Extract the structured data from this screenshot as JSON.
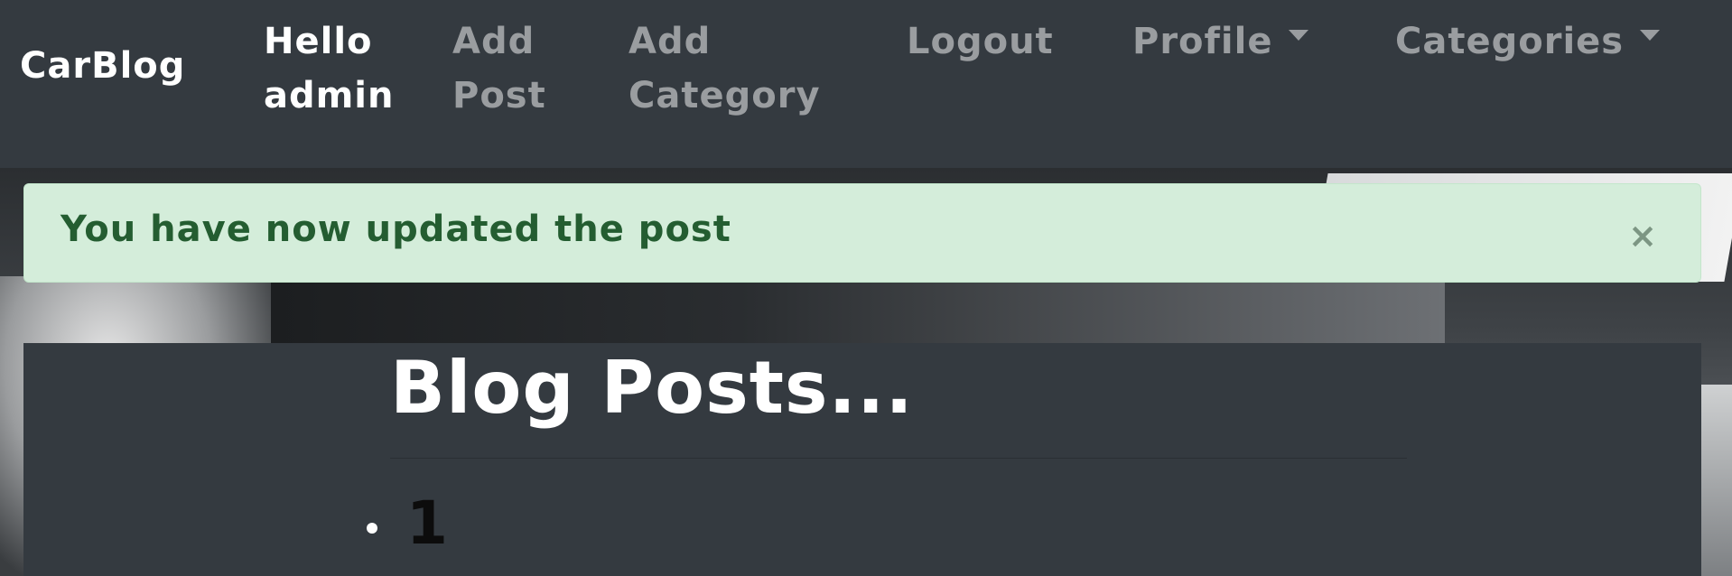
{
  "navbar": {
    "brand": "CarBlog",
    "greeting_line1": "Hello",
    "greeting_line2": "admin",
    "add_post_line1": "Add",
    "add_post_line2": "Post",
    "add_category_line1": "Add",
    "add_category_line2": "Category",
    "logout": "Logout",
    "profile": "Profile",
    "categories": "Categories"
  },
  "alert": {
    "message": "You have now updated the post",
    "close": "×"
  },
  "main": {
    "title": "Blog Posts...",
    "posts": [
      {
        "label": "1"
      }
    ]
  },
  "colors": {
    "navbar_bg": "#343a40",
    "alert_bg": "#d4edda",
    "alert_text": "#245d31"
  }
}
